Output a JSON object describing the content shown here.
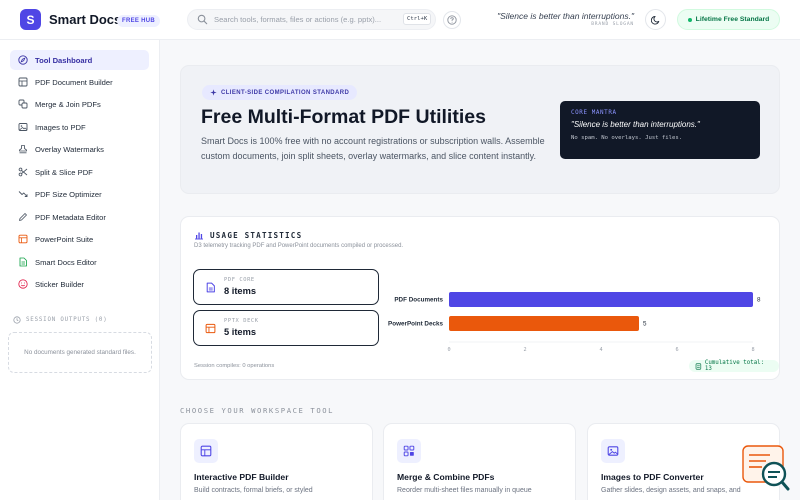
{
  "app": {
    "logo_letter": "S",
    "name": "Smart Docs",
    "badge": "FREE HUB"
  },
  "search": {
    "placeholder": "Search tools, formats, files or actions (e.g. pptx)...",
    "shortcut": "Ctrl+K"
  },
  "header": {
    "quote": "\"Silence is better than interruptions.\"",
    "quote_attr": "BRAND SLOGAN",
    "standard_pill": "Lifetime Free Standard"
  },
  "sidebar": {
    "items": [
      {
        "label": "Tool Dashboard",
        "icon": "compass-icon",
        "active": true
      },
      {
        "label": "PDF Document Builder",
        "icon": "document-grid-icon"
      },
      {
        "label": "Merge & Join PDFs",
        "icon": "merge-icon"
      },
      {
        "label": "Images to PDF",
        "icon": "image-icon"
      },
      {
        "label": "Overlay Watermarks",
        "icon": "stamp-icon"
      },
      {
        "label": "Split & Slice PDF",
        "icon": "scissors-icon"
      },
      {
        "label": "PDF Size Optimizer",
        "icon": "trend-down-icon"
      },
      {
        "label": "PDF Metadata Editor",
        "icon": "pen-icon"
      },
      {
        "label": "PowerPoint Suite",
        "icon": "presentation-icon"
      },
      {
        "label": "Smart Docs Editor",
        "icon": "doc-edit-icon"
      },
      {
        "label": "Sticker Builder",
        "icon": "smile-icon"
      }
    ],
    "outputs_title": "SESSION OUTPUTS (0)",
    "outputs_empty": "No documents generated standard files."
  },
  "hero": {
    "badge": "CLIENT-SIDE COMPILATION STANDARD",
    "title": "Free Multi-Format PDF Utilities",
    "description": "Smart Docs is 100% free with no account registrations or subscription walls. Assemble custom documents, join split sheets, overlay watermarks, and slice content instantly.",
    "mantra_title": "CORE MANTRA",
    "mantra_quote": "\"Silence is better than interruptions.\"",
    "mantra_sub": "No spam. No overlays. Just files."
  },
  "stats": {
    "title": "USAGE STATISTICS",
    "subtitle": "D3 telemetry tracking PDF and PowerPoint documents compiled or processed.",
    "cards": [
      {
        "label": "PDF CORE",
        "value": "8 items",
        "icon": "file-icon"
      },
      {
        "label": "PPTX DECK",
        "value": "5 items",
        "icon": "slides-icon"
      }
    ],
    "footer": "Session compiles: 0 operations",
    "cumulative": "Cumulative total: 13"
  },
  "chart_data": {
    "type": "bar",
    "orientation": "horizontal",
    "categories": [
      "PDF Documents",
      "PowerPoint Decks"
    ],
    "values": [
      8,
      5
    ],
    "colors": [
      "#4f46e5",
      "#ea580c"
    ],
    "xlim": [
      0,
      8
    ],
    "xticks": [
      "0",
      "2",
      "4",
      "6",
      "8"
    ],
    "data_labels": [
      "8",
      "5"
    ],
    "grid": false
  },
  "workspace": {
    "title": "CHOOSE YOUR WORKSPACE TOOL",
    "tools": [
      {
        "title": "Interactive PDF Builder",
        "desc": "Build contracts, formal briefs, or styled",
        "icon": "layout-icon"
      },
      {
        "title": "Merge & Combine PDFs",
        "desc": "Reorder multi-sheet files manually in queue",
        "icon": "merge-icon"
      },
      {
        "title": "Images to PDF Converter",
        "desc": "Gather slides, design assets, and snaps, and",
        "icon": "image-icon"
      }
    ]
  },
  "colors": {
    "accent": "#4f46e5",
    "orange": "#ea580c",
    "success": "#12b76a",
    "dark": "#111827"
  }
}
